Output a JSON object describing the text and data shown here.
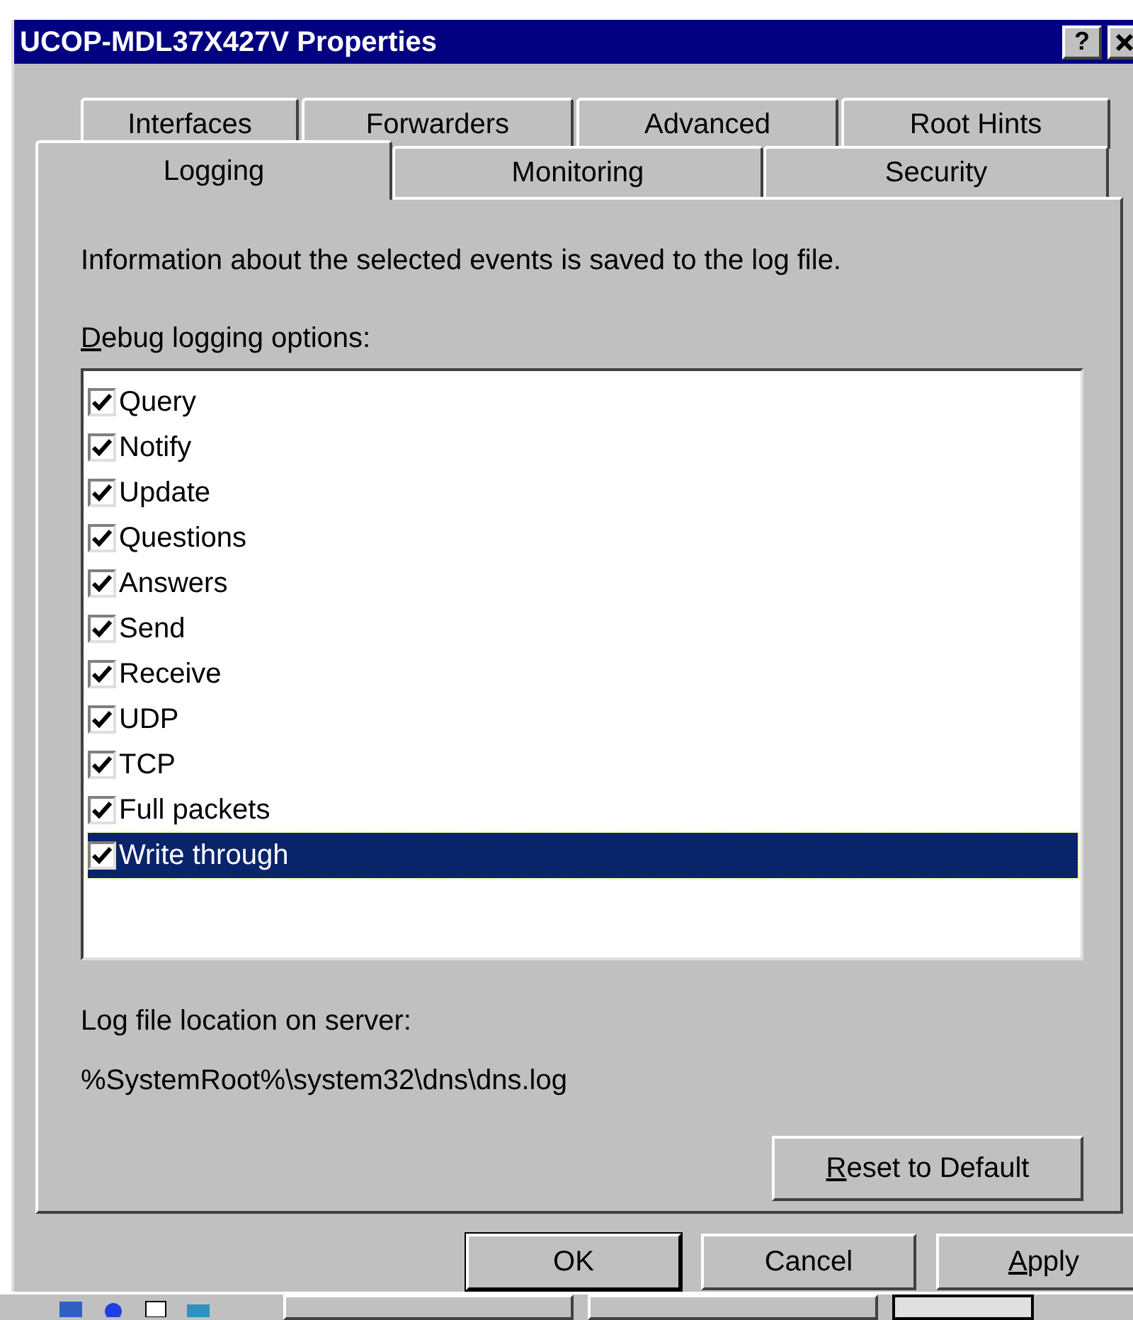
{
  "window": {
    "title": "UCOP-MDL37X427V Properties",
    "help_button": "?"
  },
  "tab_rows": [
    {
      "tabs": [
        {
          "label": "Interfaces",
          "selected": false
        },
        {
          "label": "Forwarders",
          "selected": false
        },
        {
          "label": "Advanced",
          "selected": false
        },
        {
          "label": "Root Hints",
          "selected": false
        }
      ]
    },
    {
      "tabs": [
        {
          "label": "Logging",
          "selected": true
        },
        {
          "label": "Monitoring",
          "selected": false
        },
        {
          "label": "Security",
          "selected": false
        }
      ]
    }
  ],
  "description": "Information about the selected events is saved to the log file.",
  "options_label": {
    "text": "Debug logging options:",
    "underline_first": true
  },
  "options": [
    {
      "label": "Query",
      "checked": true,
      "selected": false
    },
    {
      "label": "Notify",
      "checked": true,
      "selected": false
    },
    {
      "label": "Update",
      "checked": true,
      "selected": false
    },
    {
      "label": "Questions",
      "checked": true,
      "selected": false
    },
    {
      "label": "Answers",
      "checked": true,
      "selected": false
    },
    {
      "label": "Send",
      "checked": true,
      "selected": false
    },
    {
      "label": "Receive",
      "checked": true,
      "selected": false
    },
    {
      "label": "UDP",
      "checked": true,
      "selected": false
    },
    {
      "label": "TCP",
      "checked": true,
      "selected": false
    },
    {
      "label": "Full packets",
      "checked": true,
      "selected": false
    },
    {
      "label": "Write through",
      "checked": true,
      "selected": true
    }
  ],
  "log_location_label": "Log file location on server:",
  "log_location": "%SystemRoot%\\system32\\dns\\dns.log",
  "reset_button": {
    "label": "Reset to Default",
    "underline_first": true
  },
  "buttons": [
    {
      "label": "OK",
      "default": true,
      "underline_first": false
    },
    {
      "label": "Cancel",
      "default": false,
      "underline_first": false
    },
    {
      "label": "Apply",
      "default": false,
      "underline_first": true
    }
  ]
}
